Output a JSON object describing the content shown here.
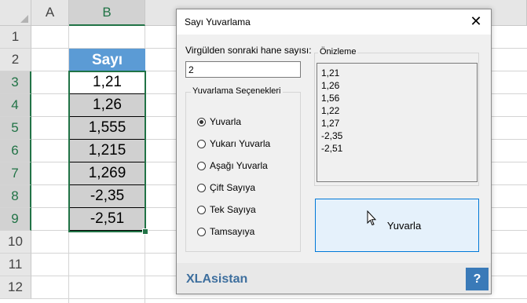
{
  "spreadsheet": {
    "columns": [
      "A",
      "B"
    ],
    "rows": [
      "1",
      "2",
      "3",
      "4",
      "5",
      "6",
      "7",
      "8",
      "9",
      "10",
      "11",
      "12"
    ],
    "header_cell": "Sayı",
    "values": [
      "1,21",
      "1,26",
      "1,555",
      "1,215",
      "1,269",
      "-2,35",
      "-2,51"
    ],
    "colors": {
      "header_fill": "#5b9bd5",
      "selection": "#217346",
      "data_fill": "#d0d0d0"
    }
  },
  "dialog": {
    "title": "Sayı Yuvarlama",
    "close_icon": "close-icon",
    "decimal_label": "Virgülden sonraki hane sayısı:",
    "decimal_value": "2",
    "options_group_label": "Yuvarlama Seçenekleri",
    "options": [
      {
        "label": "Yuvarla",
        "checked": true
      },
      {
        "label": "Yukarı Yuvarla",
        "checked": false
      },
      {
        "label": "Aşağı Yuvarla",
        "checked": false
      },
      {
        "label": "Çift Sayıya",
        "checked": false
      },
      {
        "label": "Tek Sayıya",
        "checked": false
      },
      {
        "label": "Tamsayıya",
        "checked": false
      }
    ],
    "preview_label": "Önizleme",
    "preview_values": [
      "1,21",
      "1,26",
      "1,56",
      "1,22",
      "1,27",
      "-2,35",
      "-2,51"
    ],
    "apply_button": "Yuvarla",
    "brand": "XLAsistan",
    "help_button": "?",
    "colors": {
      "brand": "#3e6f9e",
      "help_bg": "#3a7ab8",
      "button_bg": "#e5f1fb",
      "button_border": "#0078d7"
    }
  }
}
